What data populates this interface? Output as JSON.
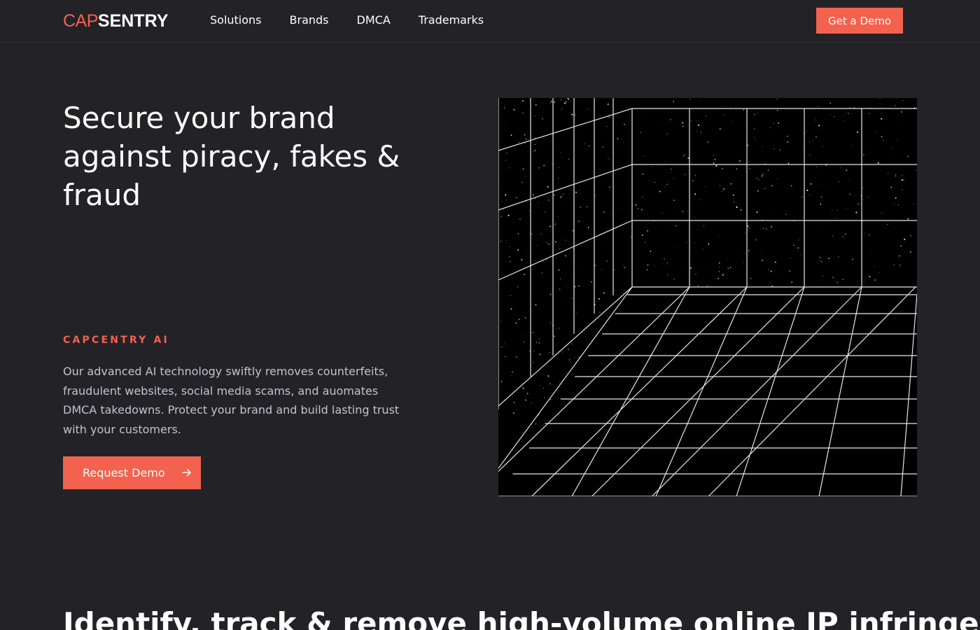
{
  "brand": {
    "logo_cap": "CAP",
    "logo_sentry": "SENTRY",
    "accent_color": "#f2624f",
    "background": "#232227"
  },
  "nav": {
    "links": [
      "Solutions",
      "Brands",
      "DMCA",
      "Trademarks"
    ],
    "cta_label": "Get a Demo"
  },
  "hero": {
    "title": "Secure your brand against piracy, fakes & fraud",
    "eyebrow": "CAPCENTRY AI",
    "description": "Our advanced AI technology swiftly removes counterfeits, fraudulent websites, social media scams, and auomates DMCA takedowns. Protect your brand and build lasting trust with your customers.",
    "cta_label": "Request Demo",
    "cta_icon": "arrow-right-icon",
    "illustration_icon": "perspective-grid-illustration"
  },
  "section": {
    "title": "Identify, track & remove high-volume online IP infringements"
  }
}
